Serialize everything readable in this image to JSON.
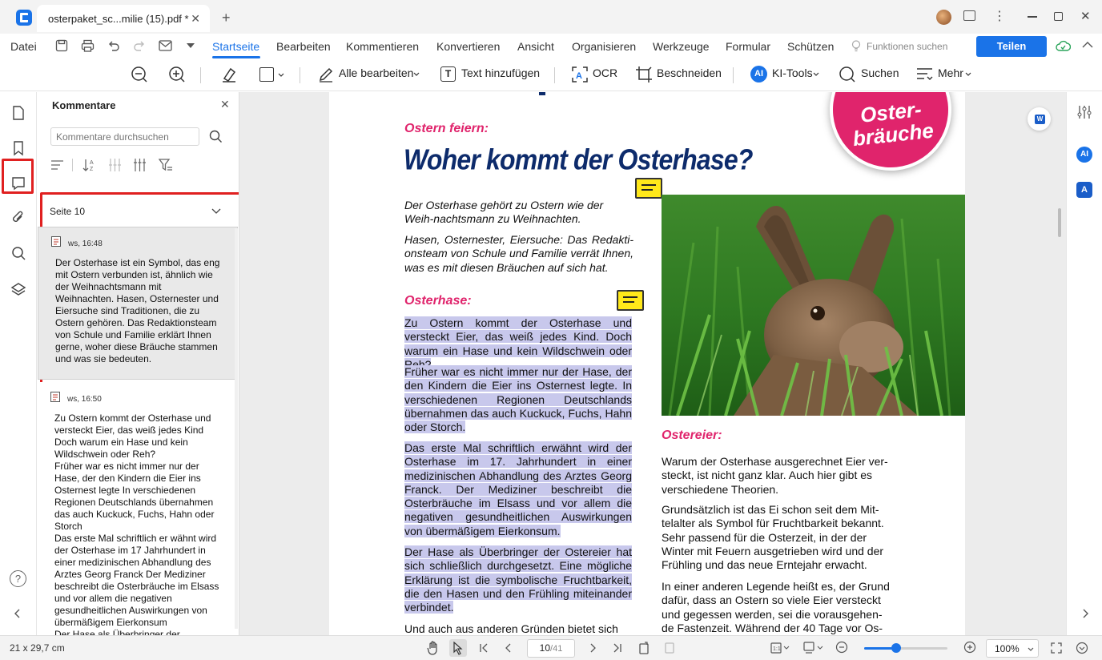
{
  "window": {
    "tab_title": "osterpaket_sc...milie (15).pdf *",
    "new_tab": "+"
  },
  "menubar": {
    "file": "Datei",
    "tabs": [
      "Startseite",
      "Bearbeiten",
      "Kommentieren",
      "Konvertieren",
      "Ansicht",
      "Organisieren",
      "Werkzeuge",
      "Formular",
      "Schützen"
    ],
    "search_functions": "Funktionen suchen",
    "share": "Teilen"
  },
  "toolbar": {
    "edit_all": "Alle bearbeiten",
    "add_text": "Text hinzufügen",
    "ocr": "OCR",
    "crop": "Beschneiden",
    "ai_tools": "KI-Tools",
    "search": "Suchen",
    "more": "Mehr"
  },
  "panel": {
    "title": "Kommentare",
    "search_placeholder": "Kommentare durchsuchen",
    "page_group": "Seite 10",
    "comments": [
      {
        "author": "ws,",
        "time": "16:48",
        "text": "Der Osterhase ist ein Symbol, das eng mit Ostern verbunden ist, ähnlich wie der Weihnachtsmann mit Weihnachten. Hasen, Osternester und Eiersuche sind Traditionen, die zu Ostern gehören. Das Redaktionsteam von Schule und Familie erklärt Ihnen gerne, woher diese Bräuche stammen und was sie bedeuten."
      },
      {
        "author": "ws,",
        "time": "16:50",
        "text": "Zu Ostern kommt der Osterhase und versteckt Eier, das weiß jedes Kind Doch warum ein Hase und kein Wildschwein oder Reh?\nFrüher war es nicht immer nur der Hase, der den Kindern die Eier ins Osternest legte  In verschiedenen Regionen Deutschlands übernahmen das auch Kuckuck, Fuchs, Hahn oder Storch\nDas erste Mal schriftlich er wähnt wird der Osterhase im 17  Jahrhundert in einer medizinischen Abhandlung des Arztes Georg Franck  Der Mediziner beschreibt die Osterbräuche im Elsass und vor allem die negativen gesundheitlichen Auswirkungen von übermäßigem Eierkonsum\nDer Hase als Überbringer der Ostereier"
      }
    ]
  },
  "document": {
    "badge_line1": "Oster-",
    "badge_line2": "bräuche",
    "kicker": "Ostern feiern:",
    "headline": "Woher kommt der Osterhase?",
    "intro1": "Der Osterhase gehört zu Ostern wie der Weih-nachtsmann zu Weihnachten.",
    "intro2": "Hasen, Osternester, Eiersuche: Das Redakti-onsteam von Schule und Familie verrät Ihnen, was es mit diesen Bräuchen auf sich hat.",
    "section1": "Osterhase:",
    "p1": "Zu Ostern kommt der Osterhase und versteckt Eier, das weiß jedes Kind. Doch warum ein Hase und kein Wildschwein oder Reh?",
    "p2": "Früher war es nicht immer nur der Hase, der den Kindern die Eier ins Osternest legte. In verschiedenen Regionen Deutschlands übernahmen das auch Kuckuck, Fuchs, Hahn oder Storch.",
    "p3": "Das erste Mal schriftlich erwähnt wird der Osterhase im 17. Jahrhundert in einer medizinischen Abhandlung des Arztes Georg Franck. Der Mediziner beschreibt die Osterbräuche im Elsass und vor allem die negativen gesundheitlichen Auswirkungen von übermäßigem Eierkonsum.",
    "p4": "Der Hase als Überbringer der Ostereier hat sich schließlich durchgesetzt. Eine mögliche Erklärung ist die symbolische Fruchtbarkeit, die den Hasen und den Frühling miteinander verbindet.",
    "p5": "Und auch aus anderen Gründen bietet sich",
    "section2": "Ostereier:",
    "r1": "Warum der Osterhase ausgerechnet Eier ver-steckt, ist nicht ganz klar. Auch hier gibt es verschiedene Theorien.",
    "r2": "Grundsätzlich ist das Ei schon seit dem Mit-telalter als Symbol für Fruchtbarkeit bekannt. Sehr passend  für die Osterzeit, in der der Winter mit Feuern ausgetrieben wird und der Frühling und das neue Erntejahr erwacht.",
    "r3": "In einer anderen Legende heißt es, der Grund dafür, dass an Ostern so viele Eier versteckt und gegessen werden, sei die vorausgehen-de Fastenzeit. Während der 40 Tage vor Os-"
  },
  "status": {
    "page_size": "21 x 29,7 cm",
    "current_page": "10",
    "total_pages": "/41",
    "zoom": "100%",
    "zoom_fraction": 0.38
  },
  "colors": {
    "accent": "#1a73e8",
    "magenta": "#e0246c",
    "navy": "#0d2b6b",
    "highlight": "#c8c8ec",
    "selection_red": "#e02020"
  }
}
